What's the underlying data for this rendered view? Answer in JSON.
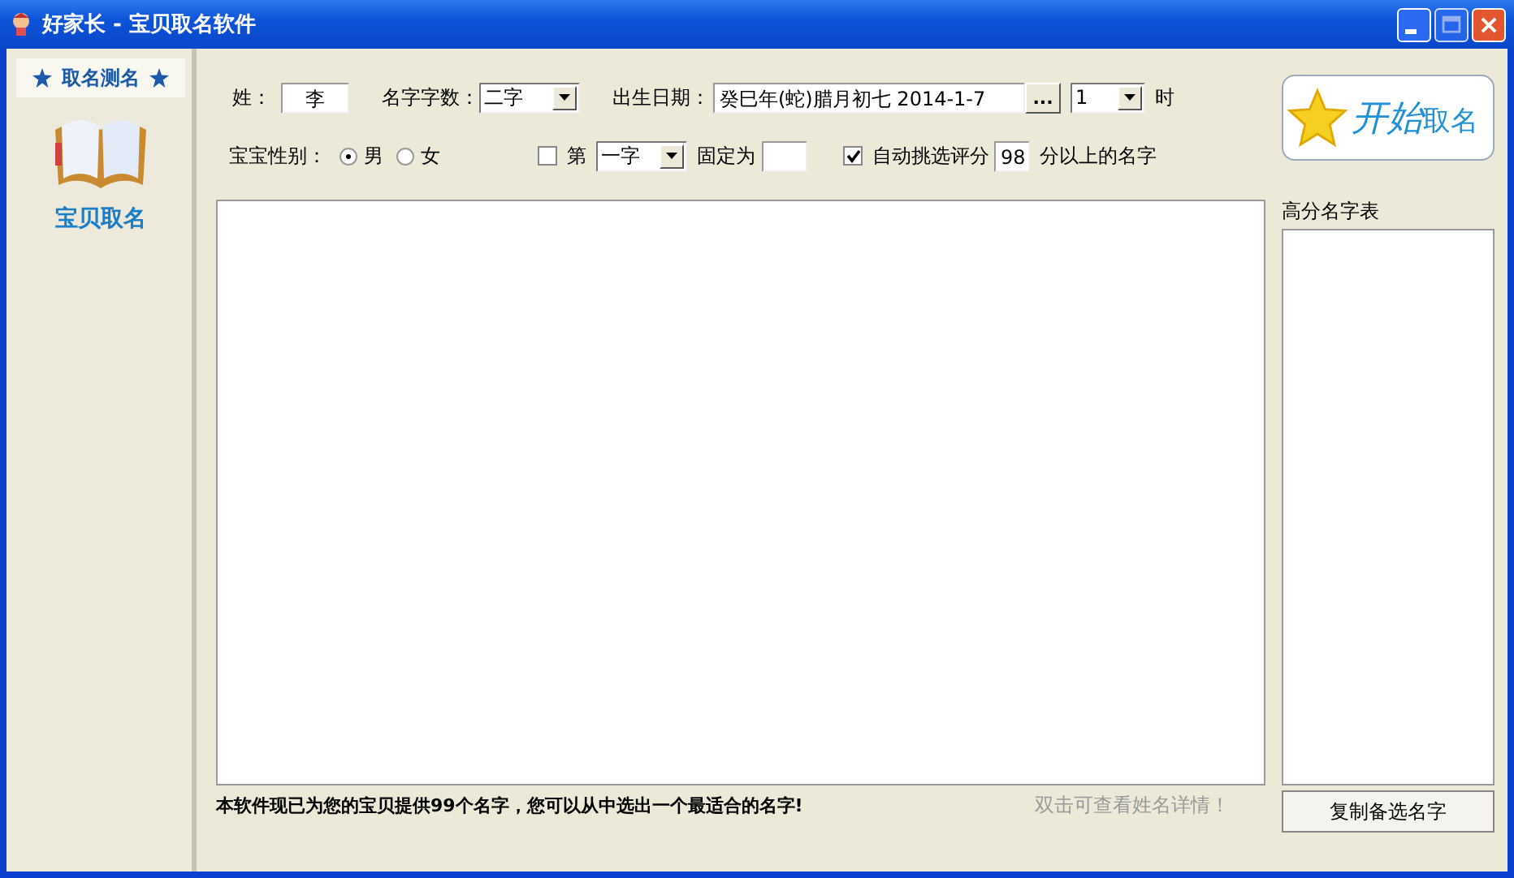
{
  "window": {
    "title": "好家长 - 宝贝取名软件"
  },
  "sidebar": {
    "header": "取名测名",
    "items": [
      {
        "label": "宝贝取名",
        "selected": true
      }
    ]
  },
  "form": {
    "surname": {
      "label": "姓：",
      "value": "李"
    },
    "name_length": {
      "label": "名字字数：",
      "value": "二字"
    },
    "birth_date": {
      "label": "出生日期：",
      "value": "癸巳年(蛇)腊月初七 2014-1-7",
      "button": "..."
    },
    "hour": {
      "value": "1",
      "suffix": "时"
    },
    "gender": {
      "label": "宝宝性别：",
      "options": [
        {
          "label": "男",
          "selected": true
        },
        {
          "label": "女",
          "selected": false
        }
      ]
    },
    "fixed_char": {
      "checked": false,
      "label": "第",
      "position": "一字",
      "suffix": "固定为"
    },
    "auto_pick": {
      "checked": true,
      "label": "自动挑选评分",
      "value": "98",
      "suffix": "分以上的名字"
    }
  },
  "start_button": {
    "big": "开始",
    "small": "取名"
  },
  "status": "本软件现已为您的宝贝提供99个名字，您可以从中选出一个最适合的名字!",
  "hint": "双击可查看姓名详情！",
  "top_names": {
    "title": "高分名字表"
  },
  "copy_button": "复制备选名字"
}
